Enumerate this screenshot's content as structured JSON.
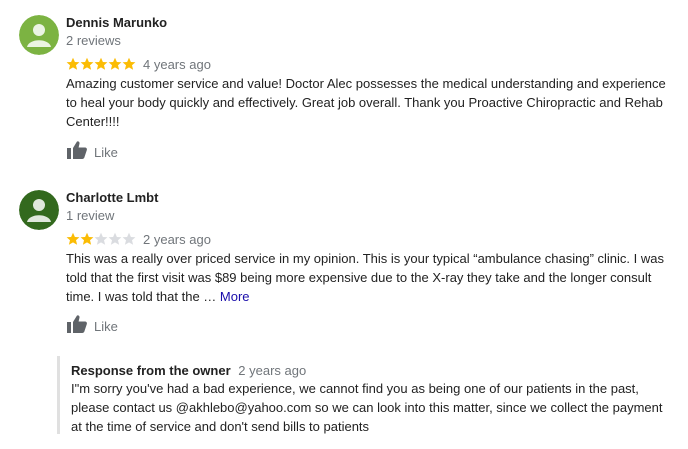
{
  "reviews": [
    {
      "name": "Dennis Marunko",
      "review_count": "2 reviews",
      "rating": 5,
      "time": "4 years ago",
      "text": "Amazing customer service and value! Doctor Alec possesses the medical understanding and experience to heal your body quickly and effectively.  Great job overall. Thank you Proactive Chiropractic and Rehab Center!!!!",
      "like_label": "Like",
      "avatar_color": "#7cb342"
    },
    {
      "name": "Charlotte Lmbt",
      "review_count": "1 review",
      "rating": 2,
      "time": "2 years ago",
      "text": "This was a really over priced service in my opinion. This is your typical “ambulance chasing” clinic. I was told that the first visit was $89 being more expensive due to the X-ray they take and the longer consult time. I was told that the …",
      "more_label": "More",
      "like_label": "Like",
      "avatar_color": "#33691e"
    }
  ],
  "owner_response": {
    "title": "Response from the owner",
    "time": "2 years ago",
    "text": "I\"m sorry you've had a bad experience, we cannot find you as being one of our patients in the past, please contact us @akhlebo@yahoo.com so we can look into this matter, since we collect the payment at the time of service and don't send bills to patients"
  },
  "colors": {
    "star_filled": "#fbbc04",
    "star_empty": "#dadce0",
    "like_icon": "#5f6368"
  }
}
